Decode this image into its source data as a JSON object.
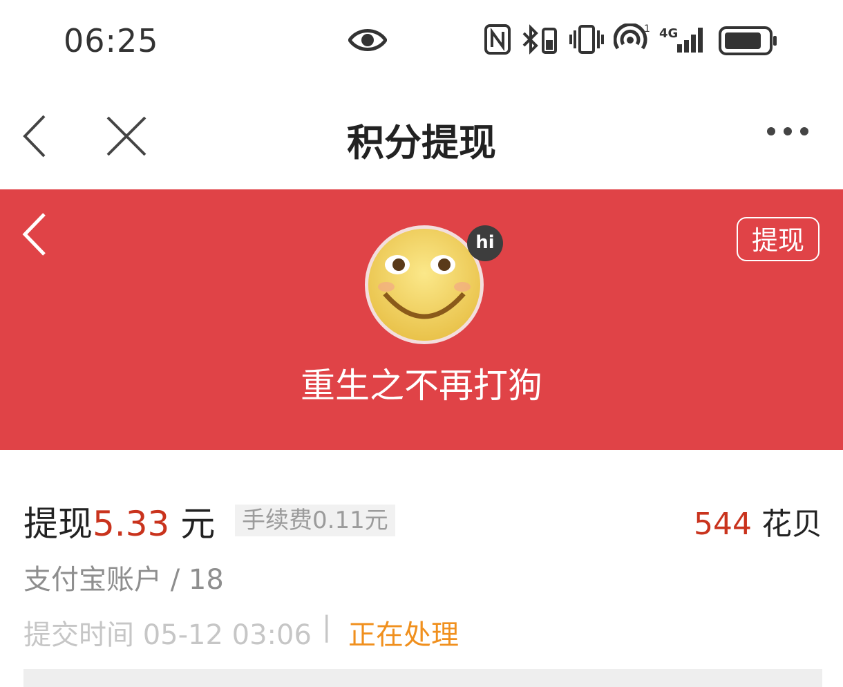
{
  "status_bar": {
    "time": "06:25",
    "signal_label": "4G",
    "sim_index": "1"
  },
  "header": {
    "title": "积分提现"
  },
  "banner": {
    "withdraw_button": "提现",
    "avatar_badge": "hi",
    "nickname": "重生之不再打狗",
    "background_color": "#e04347"
  },
  "record": {
    "withdraw_prefix": "提现",
    "amount": "5.33",
    "unit": " 元",
    "fee": "手续费0.11元",
    "points_value": "544",
    "points_unit": " 花贝",
    "account": "支付宝账户 / 18",
    "submit_time": "提交时间 05-12 03:06",
    "separator": "|",
    "status": "正在处理",
    "amount_color": "#c9331d",
    "status_color": "#f0901e"
  }
}
